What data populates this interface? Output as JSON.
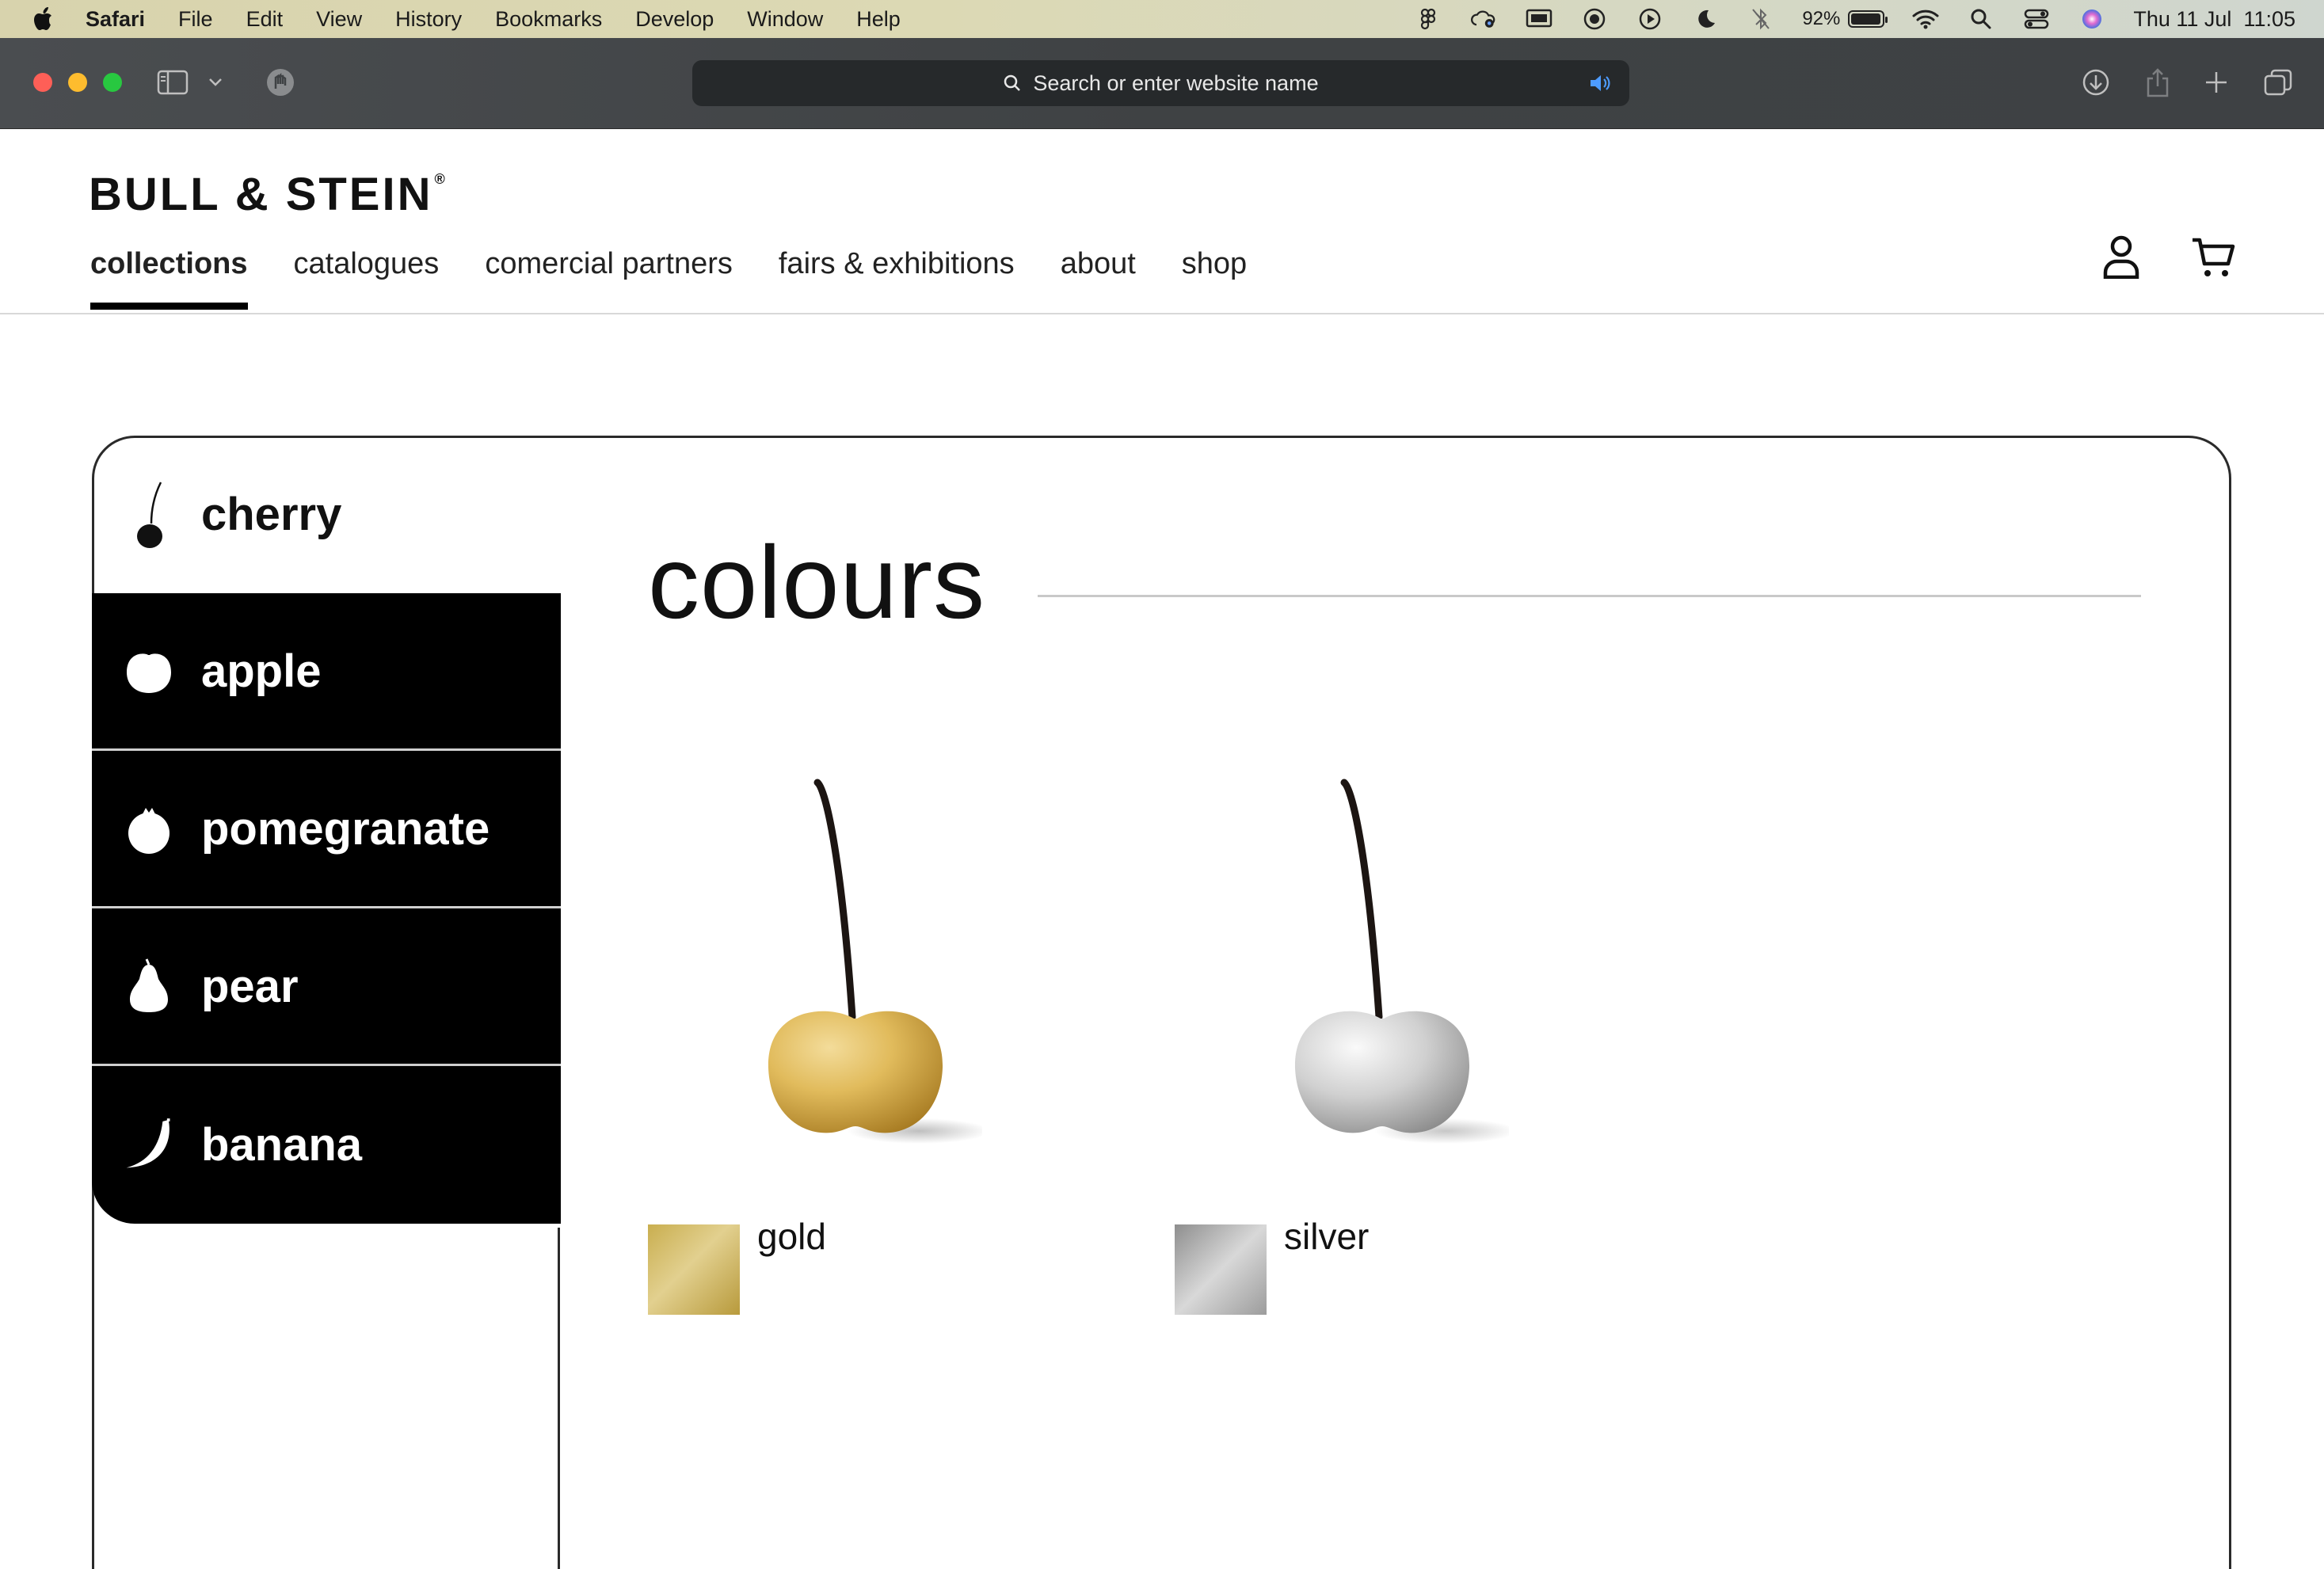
{
  "menubar": {
    "app_name": "Safari",
    "menus": [
      "File",
      "Edit",
      "View",
      "History",
      "Bookmarks",
      "Develop",
      "Window",
      "Help"
    ],
    "battery_percent": "92%",
    "battery_level": 0.92,
    "datetime": "Thu 11 Jul  11:05",
    "status_icons": [
      "figma-icon",
      "creative-cloud-icon",
      "screen-mirror-icon",
      "record-icon",
      "play-icon",
      "moon-icon",
      "bluetooth-off-icon",
      "battery-icon",
      "wifi-icon",
      "search-icon",
      "control-center-icon",
      "siri-icon"
    ]
  },
  "browser": {
    "address_placeholder": "Search or enter website name",
    "toolbar_icons": [
      "sidebar-icon",
      "chevron-down-icon",
      "privacy-shield-icon",
      "download-icon",
      "share-icon",
      "new-tab-icon",
      "tab-overview-icon"
    ]
  },
  "site": {
    "logo": "BULL & STEIN",
    "logo_mark": "®",
    "nav": [
      {
        "label": "collections",
        "active": true
      },
      {
        "label": "catalogues"
      },
      {
        "label": "comercial partners"
      },
      {
        "label": "fairs & exhibitions"
      },
      {
        "label": "about"
      },
      {
        "label": "shop"
      }
    ],
    "header_icons": [
      "user-icon",
      "cart-icon"
    ]
  },
  "sidebar": {
    "fruits": [
      {
        "label": "cherry",
        "icon": "cherry-icon",
        "active": true
      },
      {
        "label": "apple",
        "icon": "apple-icon"
      },
      {
        "label": "pomegranate",
        "icon": "pomegranate-icon"
      },
      {
        "label": "pear",
        "icon": "pear-icon"
      },
      {
        "label": "banana",
        "icon": "banana-icon"
      }
    ]
  },
  "main": {
    "section_title": "colours",
    "colours": [
      {
        "label": "gold",
        "swatch_color": "#d2b85e"
      },
      {
        "label": "silver",
        "swatch_color": "#b9b9b9"
      }
    ]
  }
}
